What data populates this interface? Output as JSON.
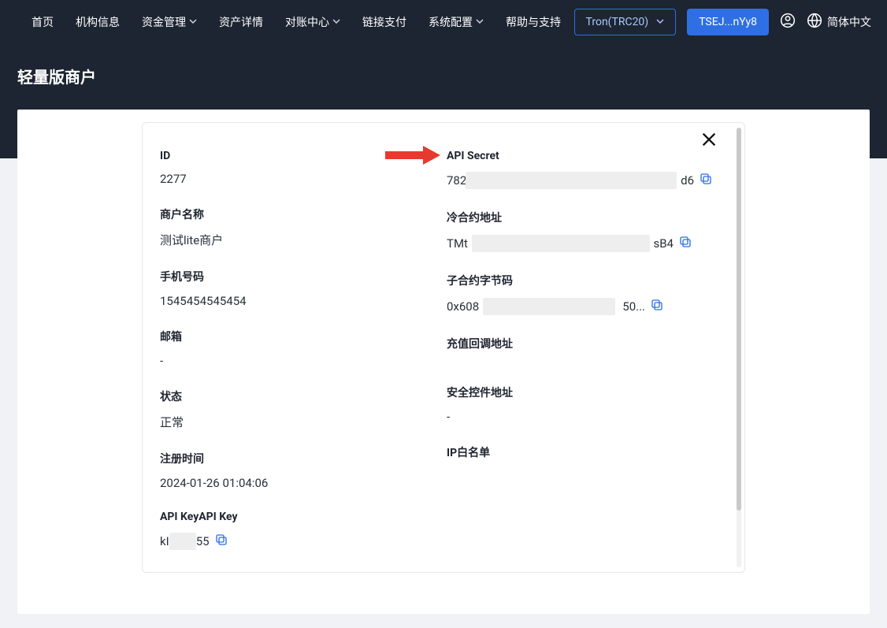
{
  "nav": {
    "items": [
      {
        "label": "首页",
        "caret": false
      },
      {
        "label": "机构信息",
        "caret": false
      },
      {
        "label": "资金管理",
        "caret": true
      },
      {
        "label": "资产详情",
        "caret": false
      },
      {
        "label": "对账中心",
        "caret": true
      },
      {
        "label": "链接支付",
        "caret": false
      },
      {
        "label": "系统配置",
        "caret": true
      },
      {
        "label": "帮助与支持",
        "caret": false
      }
    ],
    "chain_btn": "Tron(TRC20)",
    "wallet_btn": "TSEJ...nYy8",
    "language": "简体中文"
  },
  "page": {
    "title": "轻量版商户"
  },
  "modal": {
    "left": [
      {
        "label": "ID",
        "value": "2277"
      },
      {
        "label": "商户名称",
        "value": "测试lite商户"
      },
      {
        "label": "手机号码",
        "value": "1545454545454"
      },
      {
        "label": "邮箱",
        "value": "-"
      },
      {
        "label": "状态",
        "value": "正常"
      },
      {
        "label": "注册时间",
        "value": "2024-01-26 01:04:06"
      },
      {
        "label": "API Key",
        "value_masked": {
          "pre": "kI",
          "mid_width": 34,
          "post": "55"
        },
        "copy": true
      }
    ],
    "right": [
      {
        "label": "API Secret",
        "value_masked": {
          "pre": "782",
          "mid_width": 260,
          "post": "d6"
        },
        "copy": true
      },
      {
        "label": "冷合约地址",
        "value_masked": {
          "pre": "TMt",
          "mid_width": 234,
          "post": "sB4"
        },
        "copy": true
      },
      {
        "label": "子合约字节码",
        "value_masked": {
          "pre": "0x608",
          "mid_width": 190,
          "post": "50..."
        },
        "copy": true
      },
      {
        "label": "充值回调地址",
        "value": ""
      },
      {
        "label": "安全控件地址",
        "value": "-"
      },
      {
        "label": "IP白名单",
        "value": ""
      }
    ]
  }
}
